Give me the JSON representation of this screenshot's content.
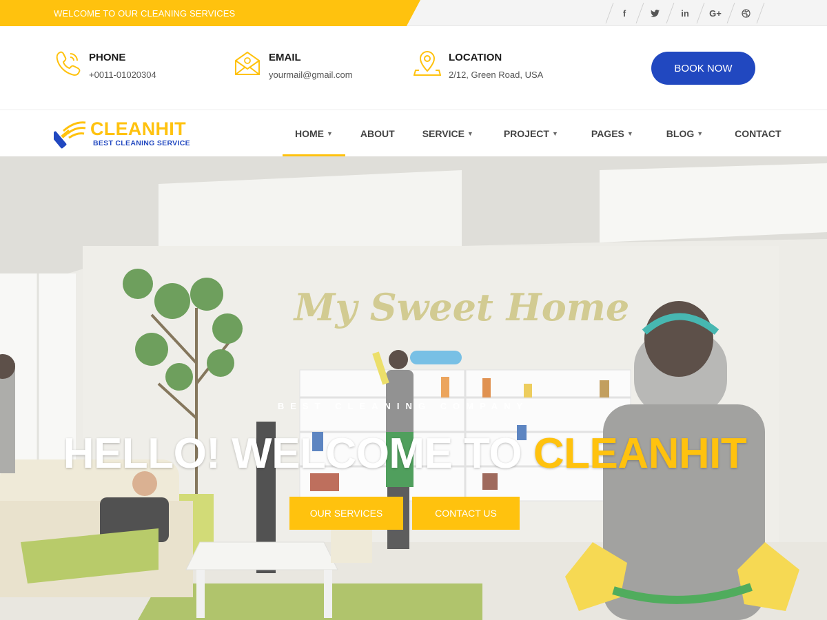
{
  "topbar": {
    "welcome": "WELCOME TO OUR CLEANING SERVICES",
    "socials": [
      {
        "icon": "facebook-icon",
        "glyph": "f"
      },
      {
        "icon": "twitter-icon",
        "glyph": "🐦"
      },
      {
        "icon": "linkedin-icon",
        "glyph": "in"
      },
      {
        "icon": "google-plus-icon",
        "glyph": "G+"
      },
      {
        "icon": "dribbble-icon",
        "glyph": "◎"
      }
    ]
  },
  "contact": {
    "phone": {
      "label": "PHONE",
      "value": "+0011-01020304",
      "icon": "phone-icon"
    },
    "email": {
      "label": "EMAIL",
      "value": "yourmail@gmail.com",
      "icon": "envelope-icon"
    },
    "location": {
      "label": "LOCATION",
      "value": "2/12, Green Road, USA",
      "icon": "location-pin-icon"
    },
    "book_label": "BOOK NOW"
  },
  "brand": {
    "name": "CLEANHIT",
    "tagline": "BEST CLEANING SERVICE"
  },
  "nav": {
    "items": [
      {
        "label": "HOME",
        "chevron": "⌄"
      },
      {
        "label": "ABOUT",
        "chevron": ""
      },
      {
        "label": "SERVICE",
        "chevron": "⌄"
      },
      {
        "label": "PROJECT",
        "chevron": "⌄"
      },
      {
        "label": "PAGES",
        "chevron": "⌄"
      },
      {
        "label": "BLOG",
        "chevron": "⌄"
      },
      {
        "label": "CONTACT",
        "chevron": ""
      }
    ],
    "active": "HOME"
  },
  "hero": {
    "wall_text": "My Sweet Home",
    "kicker": "BEST CLEANING COMPANY",
    "headline_prefix": "HELLO! WELCOME TO ",
    "headline_highlight": "CLEANHIT",
    "buttons": {
      "services": "OUR SERVICES",
      "contact": "CONTACT US"
    }
  },
  "colors": {
    "accent": "#ffc20e",
    "primary": "#2148c0"
  }
}
